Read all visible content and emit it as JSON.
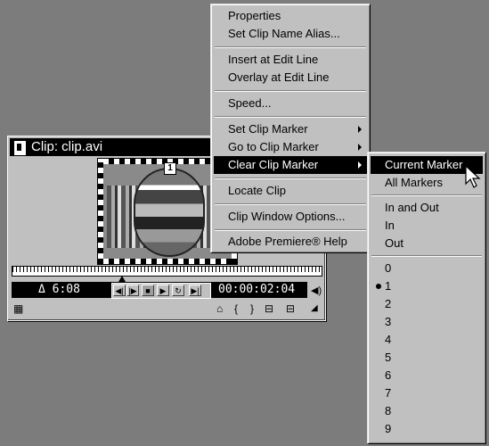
{
  "clip_window": {
    "title": "Clip: clip.avi",
    "marker_badge": "1",
    "duration": "Δ 6:08",
    "timecode": "00:00:02:04",
    "transport_icons": [
      "step-back-icon",
      "step-forward-icon",
      "stop-icon",
      "play-icon",
      "loop-icon",
      "play-to-end-icon"
    ],
    "bottom_icons": [
      "filmstrip-icon",
      "mark-in-out-icon",
      "set-in-icon",
      "set-out-icon",
      "insert-icon",
      "overlay-icon"
    ]
  },
  "main_menu": {
    "items": [
      {
        "label": "Properties"
      },
      {
        "label": "Set Clip Name Alias..."
      },
      {
        "label": "Insert at Edit Line"
      },
      {
        "label": "Overlay at Edit Line"
      },
      {
        "label": "Speed..."
      },
      {
        "label": "Set Clip Marker"
      },
      {
        "label": "Go to Clip Marker"
      },
      {
        "label": "Clear Clip Marker"
      },
      {
        "label": "Locate Clip"
      },
      {
        "label": "Clip Window Options..."
      },
      {
        "label": "Adobe Premiere® Help"
      }
    ],
    "highlighted": "Clear Clip Marker"
  },
  "sub_menu": {
    "items": [
      {
        "label": "Current Marker"
      },
      {
        "label": "All Markers"
      },
      {
        "label": "In and Out"
      },
      {
        "label": "In"
      },
      {
        "label": "Out"
      },
      {
        "label": "0"
      },
      {
        "label": "1"
      },
      {
        "label": "2"
      },
      {
        "label": "3"
      },
      {
        "label": "4"
      },
      {
        "label": "5"
      },
      {
        "label": "6"
      },
      {
        "label": "7"
      },
      {
        "label": "8"
      },
      {
        "label": "9"
      }
    ],
    "highlighted": "Current Marker",
    "bulleted": "1"
  }
}
